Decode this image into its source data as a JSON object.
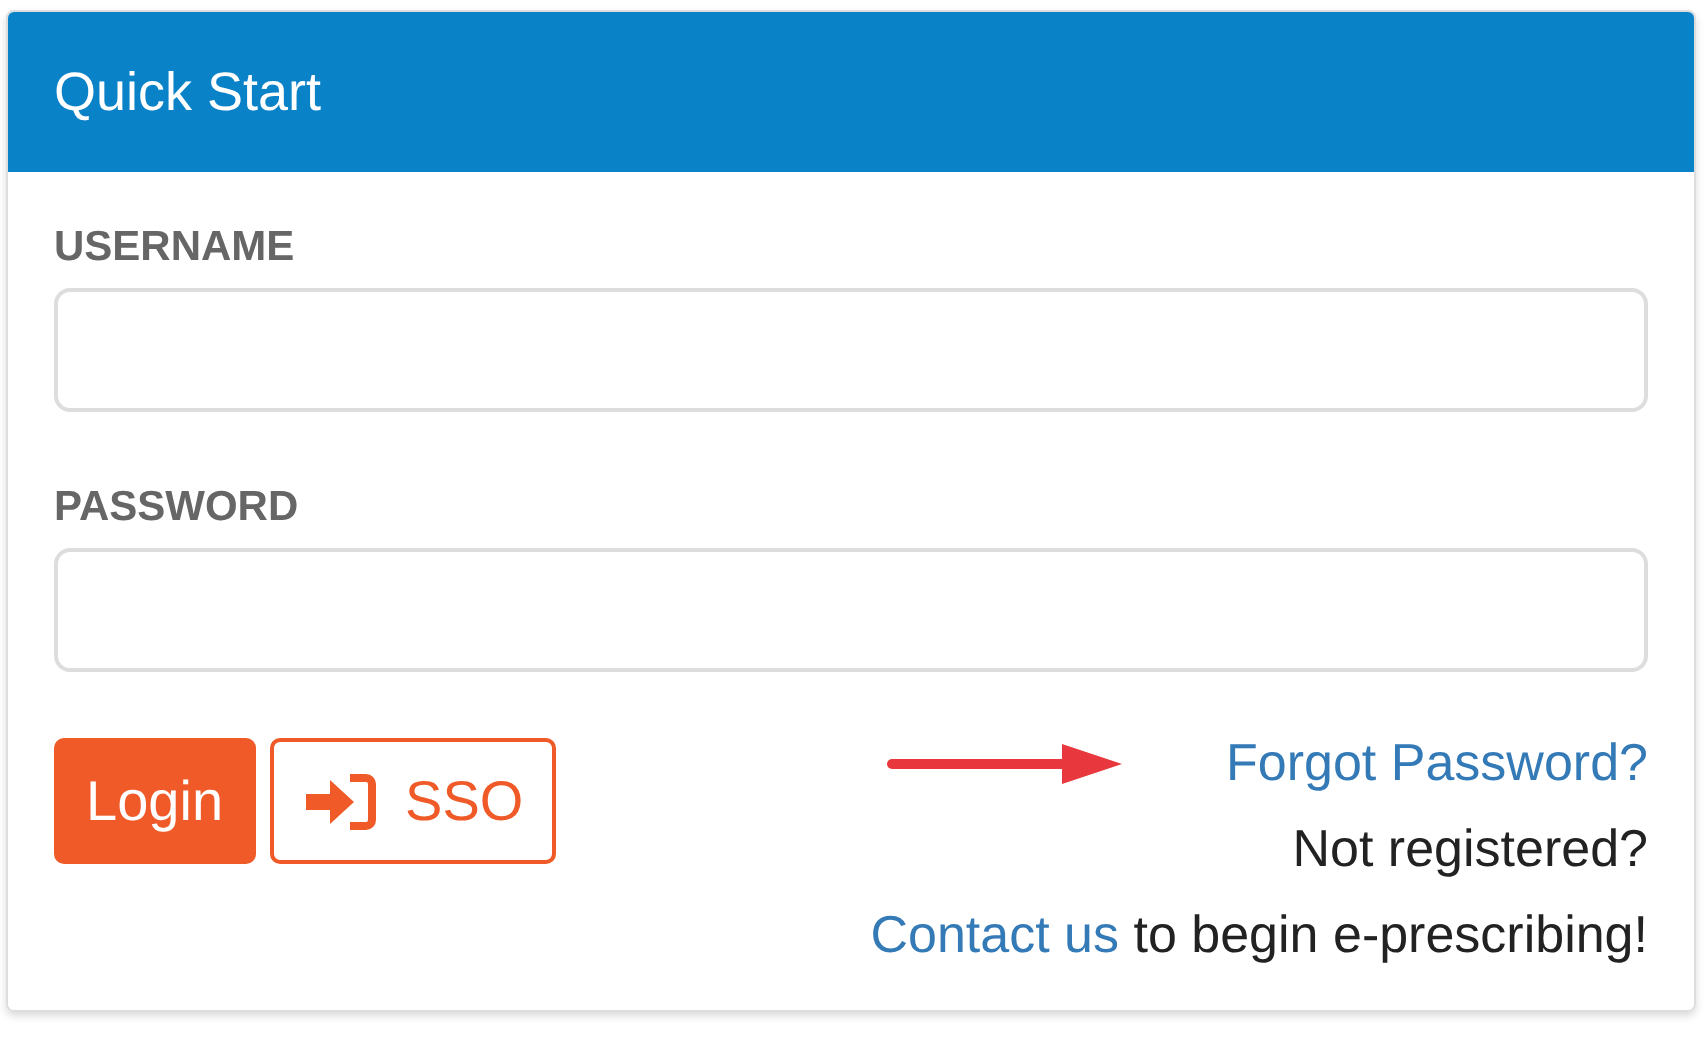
{
  "panel": {
    "title": "Quick Start"
  },
  "fields": [
    {
      "label": "USERNAME"
    },
    {
      "label": "PASSWORD"
    }
  ],
  "buttons": [
    {
      "label": "Login",
      "kind": "solid"
    },
    {
      "label": "SSO",
      "kind": "outline"
    }
  ],
  "forgot_link": "Forgot Password?",
  "register": {
    "question": "Not registered?",
    "link": "Contact us",
    "rest": "to begin e-prescribing!"
  }
}
